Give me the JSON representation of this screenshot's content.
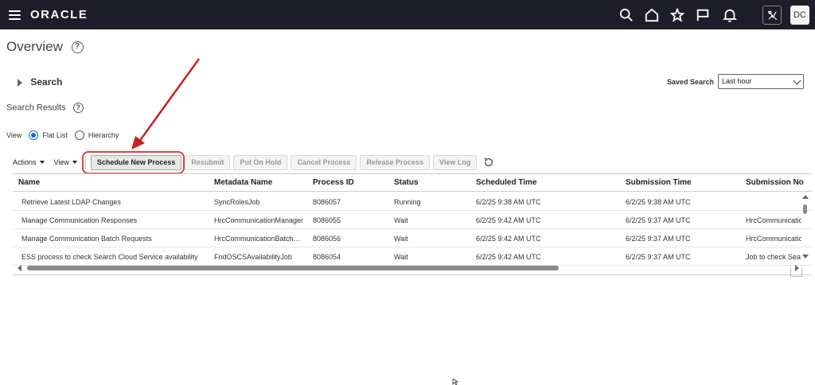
{
  "header": {
    "logo": "ORACLE",
    "avatar_initials": "DC",
    "icons": [
      "menu-icon",
      "search-icon",
      "home-icon",
      "favorites-star-icon",
      "flag-icon",
      "notifications-bell-icon",
      "accessibility-icon"
    ]
  },
  "page": {
    "title": "Overview",
    "search_label": "Search",
    "saved_search_label": "Saved Search",
    "saved_search_value": "Last hour",
    "results_title": "Search Results"
  },
  "view": {
    "label": "View",
    "options": [
      "Flat List",
      "Hierarchy"
    ],
    "selected": "Flat List"
  },
  "toolbar": {
    "actions_label": "Actions",
    "view_label": "View",
    "schedule_new_process": "Schedule New Process",
    "resubmit": "Resubmit",
    "put_on_hold": "Put On Hold",
    "cancel_process": "Cancel Process",
    "release_process": "Release Process",
    "view_log": "View Log"
  },
  "table": {
    "columns": [
      "Name",
      "Metadata Name",
      "Process ID",
      "Status",
      "Scheduled Time",
      "Submission Time",
      "Submission No"
    ],
    "rows": [
      {
        "name": "Retrieve Latest LDAP Changes",
        "metadata": "SyncRolesJob",
        "process_id": "8086057",
        "status": "Running",
        "scheduled": "6/2/25 9:38 AM UTC",
        "submission": "6/2/25 9:38 AM UTC",
        "submission_notes": ""
      },
      {
        "name": "Manage Communication Responses",
        "metadata": "HrcCommunicationManager",
        "process_id": "8086055",
        "status": "Wait",
        "scheduled": "6/2/25 9:42 AM UTC",
        "submission": "6/2/25 9:37 AM UTC",
        "submission_notes": "HrcCommunicatio"
      },
      {
        "name": "Manage Communication Batch Requests",
        "metadata": "HrcCommunicationBatch…",
        "process_id": "8086056",
        "status": "Wait",
        "scheduled": "6/2/25 9:42 AM UTC",
        "submission": "6/2/25 9:37 AM UTC",
        "submission_notes": "HrcCommunicatio"
      },
      {
        "name": "ESS process to check Search Cloud Service availability",
        "metadata": "FndOSCSAvailabilityJob",
        "process_id": "8086054",
        "status": "Wait",
        "scheduled": "6/2/25 9:42 AM UTC",
        "submission": "6/2/25 9:37 AM UTC",
        "submission_notes": "Job to check Sea"
      }
    ]
  },
  "colors": {
    "topbar": "#1e1e2a",
    "annotation": "#cc1f1f",
    "radio_selected": "#1e66c6"
  }
}
